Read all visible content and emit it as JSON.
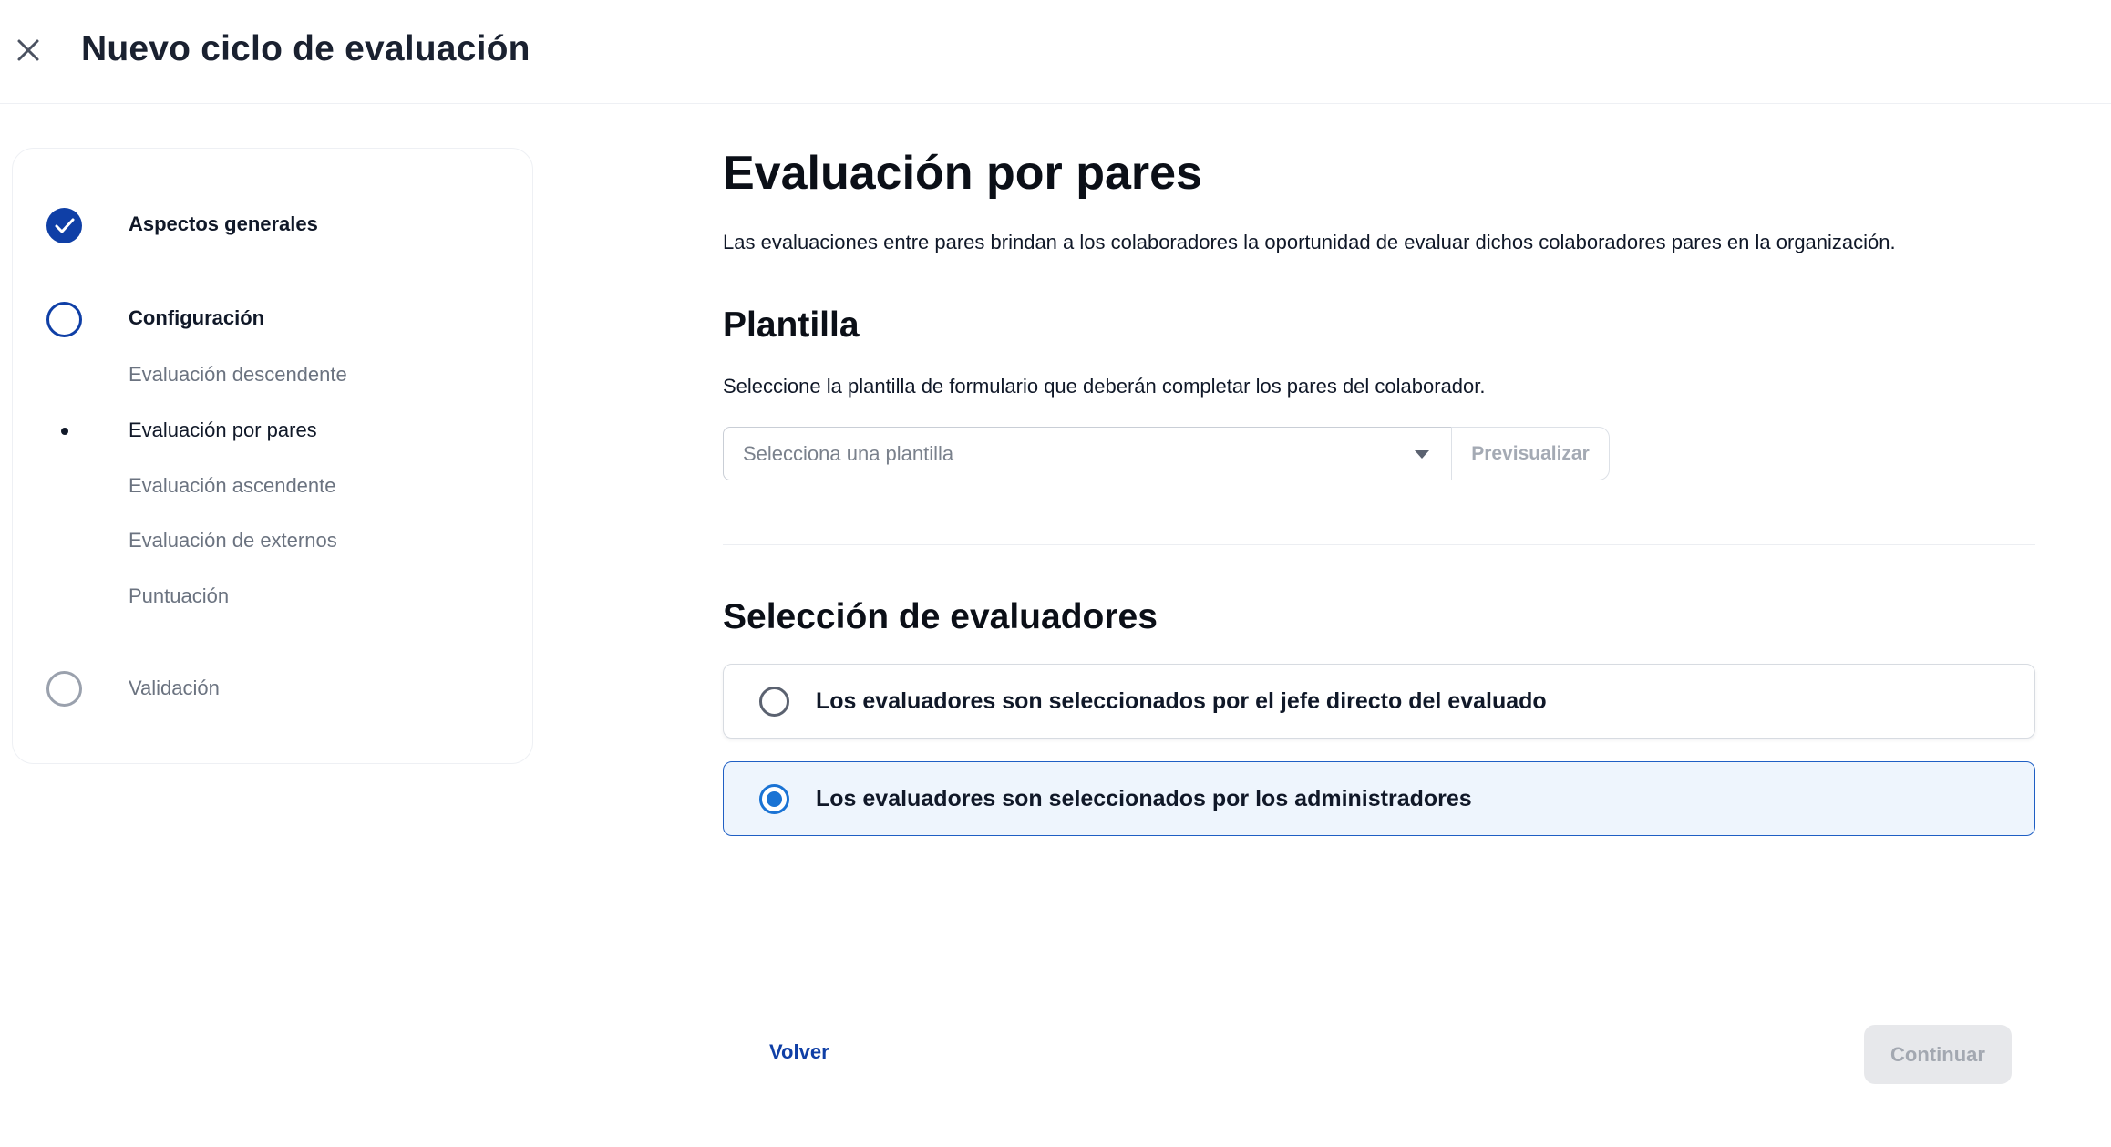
{
  "header": {
    "title": "Nuevo ciclo de evaluación",
    "close_icon": "close-icon"
  },
  "stepper": {
    "steps": [
      {
        "label": "Aspectos generales",
        "status": "done"
      },
      {
        "label": "Configuración",
        "status": "active"
      },
      {
        "label": "Validación",
        "status": "pending"
      }
    ],
    "substeps": [
      {
        "label": "Evaluación descendente",
        "current": false
      },
      {
        "label": "Evaluación por pares",
        "current": true
      },
      {
        "label": "Evaluación ascendente",
        "current": false
      },
      {
        "label": "Evaluación de externos",
        "current": false
      },
      {
        "label": "Puntuación",
        "current": false
      }
    ]
  },
  "main": {
    "title": "Evaluación por pares",
    "description": "Las evaluaciones entre pares brindan a los colaboradores la oportunidad de evaluar dichos colaboradores pares en la organización.",
    "template_section": {
      "title": "Plantilla",
      "description": "Seleccione la plantilla de formulario que deberán completar los pares del colaborador.",
      "select_placeholder": "Selecciona una plantilla",
      "preview_label": "Previsualizar"
    },
    "evaluators_section": {
      "title": "Selección de evaluadores",
      "options": [
        {
          "label": "Los evaluadores son seleccionados por el jefe directo del evaluado",
          "selected": false
        },
        {
          "label": "Los evaluadores son seleccionados por los administradores",
          "selected": true
        }
      ]
    }
  },
  "footer": {
    "back_label": "Volver",
    "continue_label": "Continuar"
  },
  "colors": {
    "primary": "#0f3fa6",
    "radio_selected": "#1a73d4",
    "selected_card_bg": "#eef5fd"
  }
}
